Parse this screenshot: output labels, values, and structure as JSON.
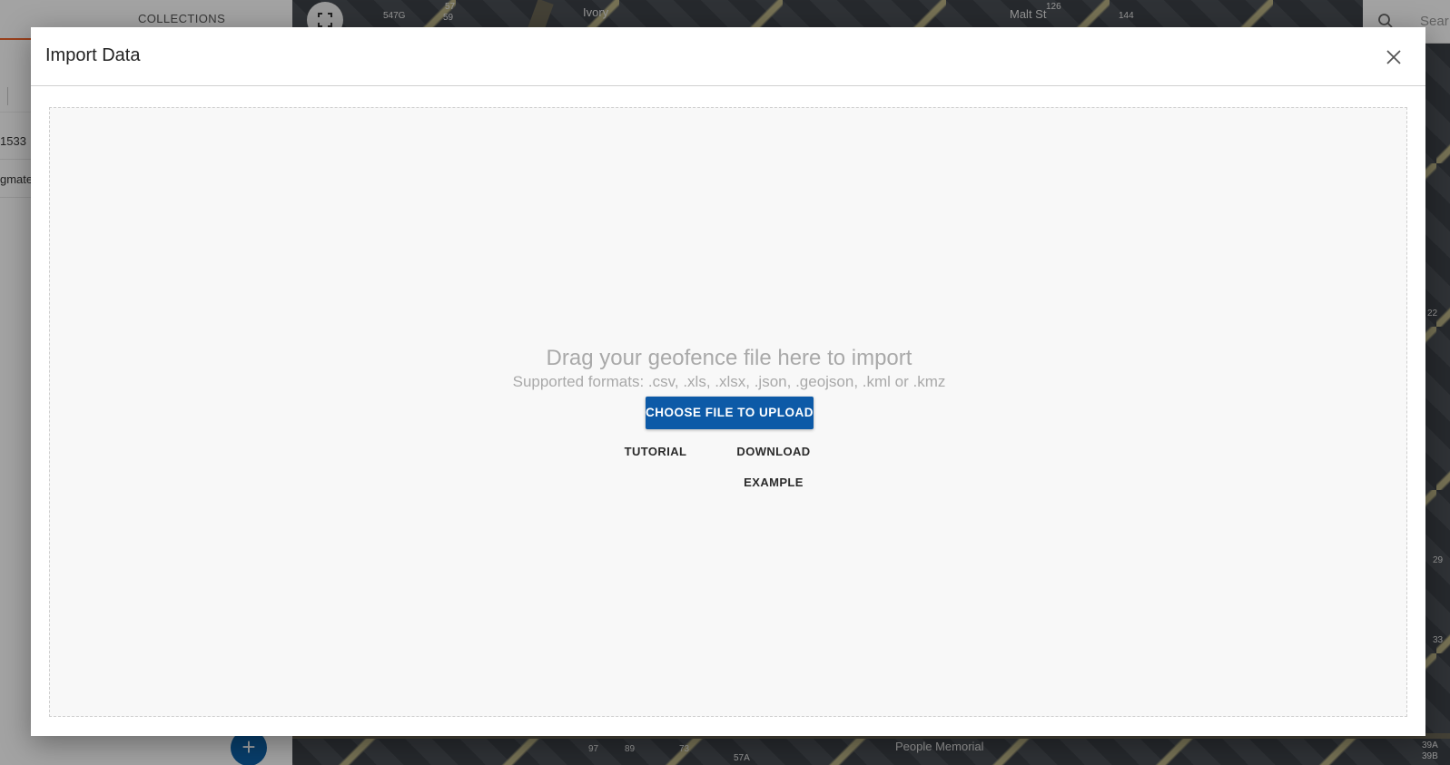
{
  "sidebar": {
    "tab_label": "COLLECTIONS",
    "items": [
      {
        "label": "1533"
      },
      {
        "label": "gmate"
      }
    ],
    "add_button_glyph": "+"
  },
  "map": {
    "labels": [
      "547G",
      "57",
      "59",
      "Ivory",
      "144",
      "126",
      "Malt St",
      "People Memorial",
      "97",
      "89",
      "73",
      "57A",
      "39A",
      "39B",
      "33",
      "29",
      "22"
    ],
    "search_placeholder": "Sear"
  },
  "modal": {
    "title": "Import Data",
    "dropzone": {
      "title": "Drag your geofence file here to import",
      "formats": "Supported formats: .csv, .xls, .xlsx, .json, .geojson, .kml or .kmz"
    },
    "choose_button": "CHOOSE FILE TO UPLOAD",
    "tutorial_button": "TUTORIAL",
    "download_button": "DOWNLOAD EXAMPLE"
  },
  "colors": {
    "primary": "#0d5aa7",
    "accent_tab": "#f0642d",
    "dropzone_bg": "#f8f8f8"
  },
  "icons": [
    "fullscreen-icon",
    "search-icon",
    "close-icon",
    "plus-icon"
  ]
}
